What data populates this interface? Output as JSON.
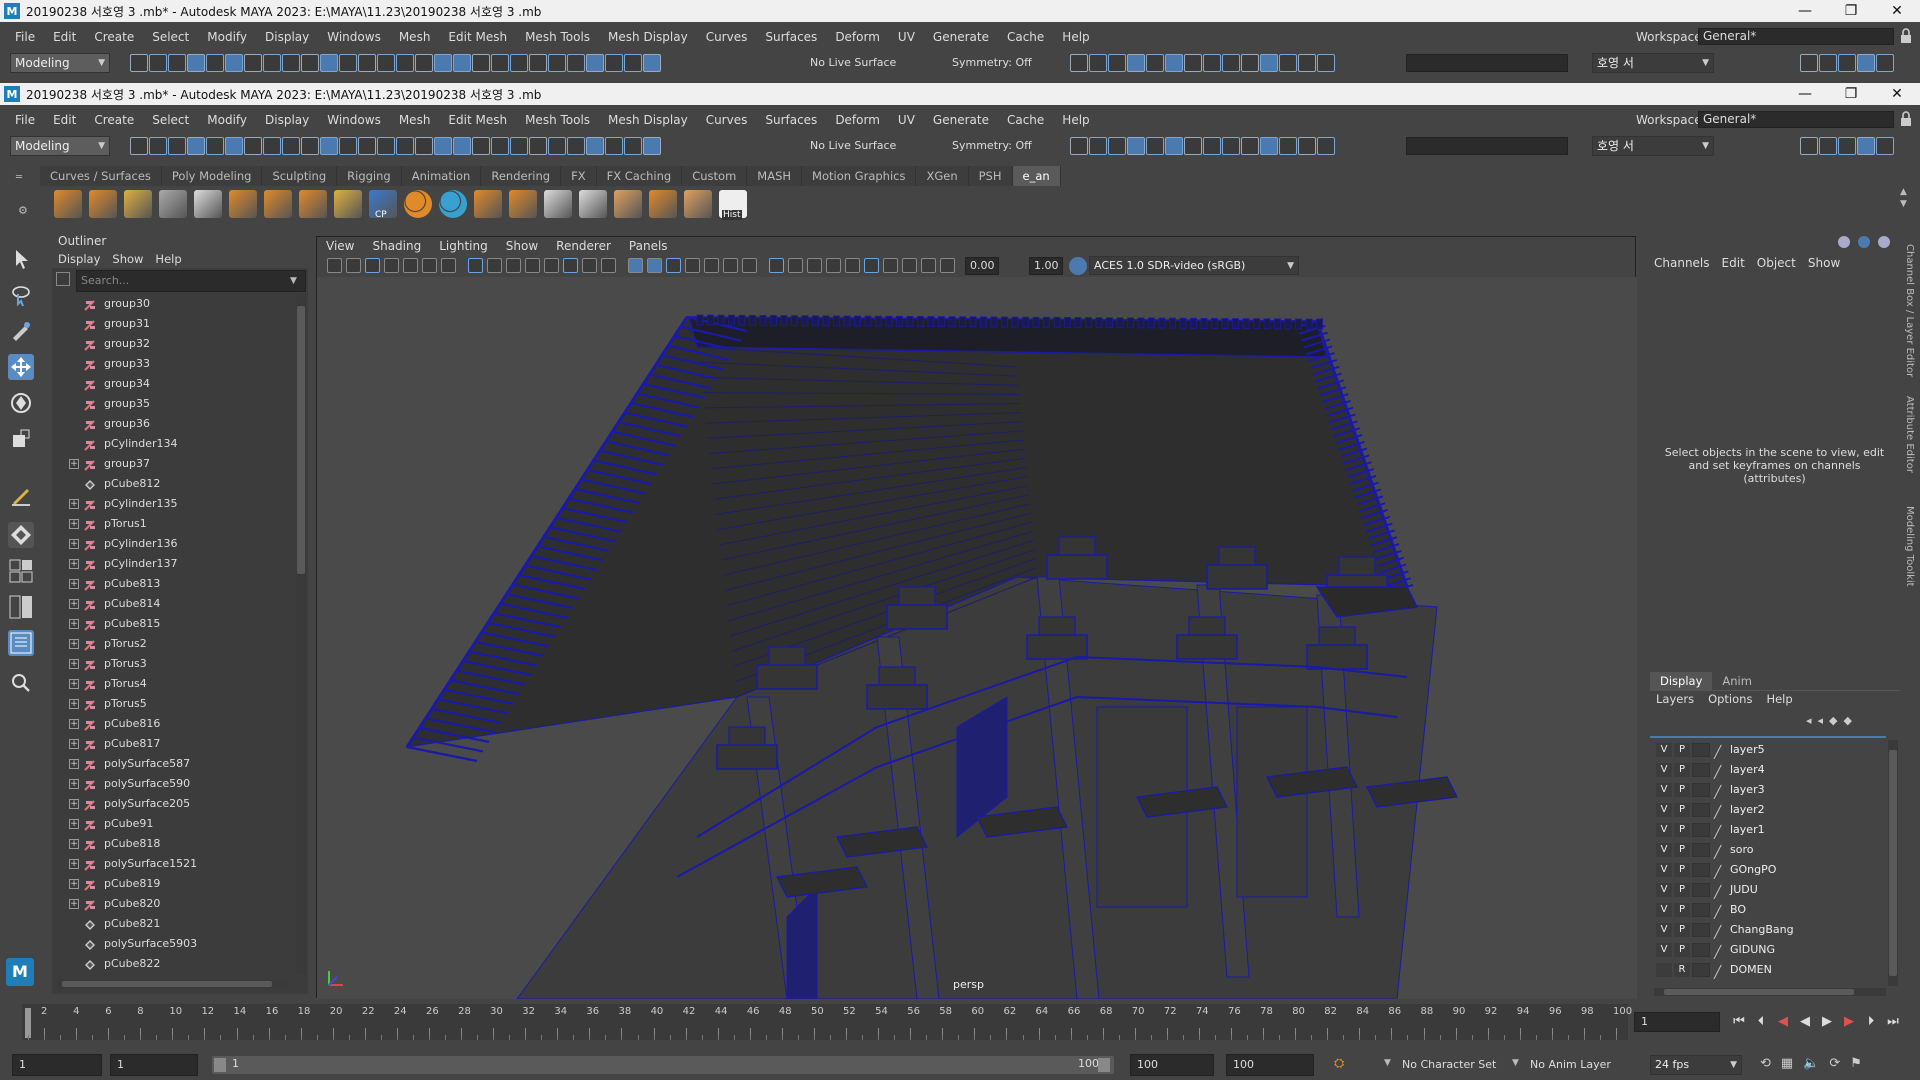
{
  "windows": [
    {
      "title": "20190238 서호영 3 .mb* - Autodesk MAYA 2023: E:\\MAYA\\11.23\\20190238 서호영 3 .mb",
      "menu": [
        "File",
        "Edit",
        "Create",
        "Select",
        "Modify",
        "Display",
        "Windows",
        "Mesh",
        "Edit Mesh",
        "Mesh Tools",
        "Mesh Display",
        "Curves",
        "Surfaces",
        "Deform",
        "UV",
        "Generate",
        "Cache",
        "Help"
      ],
      "workspace_label": "Workspace:",
      "workspace_value": "General*",
      "mode": "Modeling",
      "live_surface": "No Live Surface",
      "symmetry": "Symmetry: Off",
      "user": "호영 서"
    },
    {
      "title": "20190238 서호영 3 .mb* - Autodesk MAYA 2023: E:\\MAYA\\11.23\\20190238 서호영 3 .mb",
      "menu": [
        "File",
        "Edit",
        "Create",
        "Select",
        "Modify",
        "Display",
        "Windows",
        "Mesh",
        "Edit Mesh",
        "Mesh Tools",
        "Mesh Display",
        "Curves",
        "Surfaces",
        "Deform",
        "UV",
        "Generate",
        "Cache",
        "Help"
      ],
      "workspace_label": "Workspace:",
      "workspace_value": "General*",
      "mode": "Modeling",
      "live_surface": "No Live Surface",
      "symmetry": "Symmetry: Off",
      "user": "호영 서"
    }
  ],
  "shelf": {
    "tabs": [
      "Curves / Surfaces",
      "Poly Modeling",
      "Sculpting",
      "Rigging",
      "Animation",
      "Rendering",
      "FX",
      "FX Caching",
      "Custom",
      "MASH",
      "Motion Graphics",
      "XGen",
      "PSH",
      "e_an"
    ],
    "active_tab": "e_an",
    "icon_labels": {
      "cp": "CP",
      "hist": "Hist"
    }
  },
  "outliner": {
    "title": "Outliner",
    "menu": [
      "Display",
      "Show",
      "Help"
    ],
    "search_placeholder": "Search...",
    "items": [
      {
        "name": "group30",
        "expand": false,
        "type": "group"
      },
      {
        "name": "group31",
        "expand": false,
        "type": "group"
      },
      {
        "name": "group32",
        "expand": false,
        "type": "group"
      },
      {
        "name": "group33",
        "expand": false,
        "type": "group"
      },
      {
        "name": "group34",
        "expand": false,
        "type": "group"
      },
      {
        "name": "group35",
        "expand": false,
        "type": "group"
      },
      {
        "name": "group36",
        "expand": false,
        "type": "group"
      },
      {
        "name": "pCylinder134",
        "expand": false,
        "type": "group"
      },
      {
        "name": "group37",
        "expand": true,
        "type": "group"
      },
      {
        "name": "pCube812",
        "expand": false,
        "type": "mesh"
      },
      {
        "name": "pCylinder135",
        "expand": true,
        "type": "group"
      },
      {
        "name": "pTorus1",
        "expand": true,
        "type": "group"
      },
      {
        "name": "pCylinder136",
        "expand": true,
        "type": "group"
      },
      {
        "name": "pCylinder137",
        "expand": true,
        "type": "group"
      },
      {
        "name": "pCube813",
        "expand": true,
        "type": "group"
      },
      {
        "name": "pCube814",
        "expand": true,
        "type": "group"
      },
      {
        "name": "pCube815",
        "expand": true,
        "type": "group"
      },
      {
        "name": "pTorus2",
        "expand": true,
        "type": "group"
      },
      {
        "name": "pTorus3",
        "expand": true,
        "type": "group"
      },
      {
        "name": "pTorus4",
        "expand": true,
        "type": "group"
      },
      {
        "name": "pTorus5",
        "expand": true,
        "type": "group"
      },
      {
        "name": "pCube816",
        "expand": true,
        "type": "group"
      },
      {
        "name": "pCube817",
        "expand": true,
        "type": "group"
      },
      {
        "name": "polySurface587",
        "expand": true,
        "type": "group"
      },
      {
        "name": "polySurface590",
        "expand": true,
        "type": "group"
      },
      {
        "name": "polySurface205",
        "expand": true,
        "type": "group"
      },
      {
        "name": "pCube91",
        "expand": true,
        "type": "group"
      },
      {
        "name": "pCube818",
        "expand": true,
        "type": "group"
      },
      {
        "name": "polySurface1521",
        "expand": true,
        "type": "group"
      },
      {
        "name": "pCube819",
        "expand": true,
        "type": "group"
      },
      {
        "name": "pCube820",
        "expand": true,
        "type": "group"
      },
      {
        "name": "pCube821",
        "expand": false,
        "type": "mesh"
      },
      {
        "name": "polySurface5903",
        "expand": false,
        "type": "mesh"
      },
      {
        "name": "pCube822",
        "expand": false,
        "type": "mesh"
      }
    ]
  },
  "viewport": {
    "menu": [
      "View",
      "Shading",
      "Lighting",
      "Show",
      "Renderer",
      "Panels"
    ],
    "exposure": "0.00",
    "gamma": "1.00",
    "color_space": "ACES 1.0 SDR-video (sRGB)",
    "camera_label": "persp"
  },
  "channel_box": {
    "menu": [
      "Channels",
      "Edit",
      "Object",
      "Show"
    ],
    "hint": "Select objects in the scene to view, edit and set keyframes on channels (attributes)",
    "side_tabs": [
      "Channel Box / Layer Editor",
      "Attribute Editor",
      "Modeling Toolkit"
    ]
  },
  "layer_editor": {
    "tabs": [
      "Display",
      "Anim"
    ],
    "active_tab": "Display",
    "menu": [
      "Layers",
      "Options",
      "Help"
    ],
    "layers": [
      {
        "v": "V",
        "p": "P",
        "name": "layer5"
      },
      {
        "v": "V",
        "p": "P",
        "name": "layer4"
      },
      {
        "v": "V",
        "p": "P",
        "name": "layer3"
      },
      {
        "v": "V",
        "p": "P",
        "name": "layer2"
      },
      {
        "v": "V",
        "p": "P",
        "name": "layer1"
      },
      {
        "v": "V",
        "p": "P",
        "name": "soro"
      },
      {
        "v": "V",
        "p": "P",
        "name": "GOngPO"
      },
      {
        "v": "V",
        "p": "P",
        "name": "JUDU"
      },
      {
        "v": "V",
        "p": "P",
        "name": "BO"
      },
      {
        "v": "V",
        "p": "P",
        "name": "ChangBang"
      },
      {
        "v": "V",
        "p": "P",
        "name": "GIDUNG"
      },
      {
        "v": "",
        "p": "R",
        "name": "DOMEN"
      }
    ]
  },
  "timeline": {
    "tick_labels": [
      "2",
      "4",
      "6",
      "8",
      "10",
      "12",
      "14",
      "16",
      "18",
      "20",
      "22",
      "24",
      "26",
      "28",
      "30",
      "32",
      "34",
      "36",
      "38",
      "40",
      "42",
      "44",
      "46",
      "48",
      "50",
      "52",
      "54",
      "56",
      "58",
      "60",
      "62",
      "64",
      "66",
      "68",
      "70",
      "72",
      "74",
      "76",
      "78",
      "80",
      "82",
      "84",
      "86",
      "88",
      "90",
      "92",
      "94",
      "96",
      "98",
      "100"
    ],
    "current_frame": "1"
  },
  "range": {
    "start": "1",
    "playback_start": "1",
    "slider_start": "1",
    "slider_end": "100",
    "playback_end": "100",
    "end": "100",
    "character_set": "No Character Set",
    "anim_layer": "No Anim Layer",
    "fps": "24 fps"
  },
  "colors": {
    "wireframe": "#1a1aa8",
    "accent": "#4a7ab0",
    "shelf_orange": "#e08a2a",
    "maya_logo": "#1f7eb8"
  }
}
